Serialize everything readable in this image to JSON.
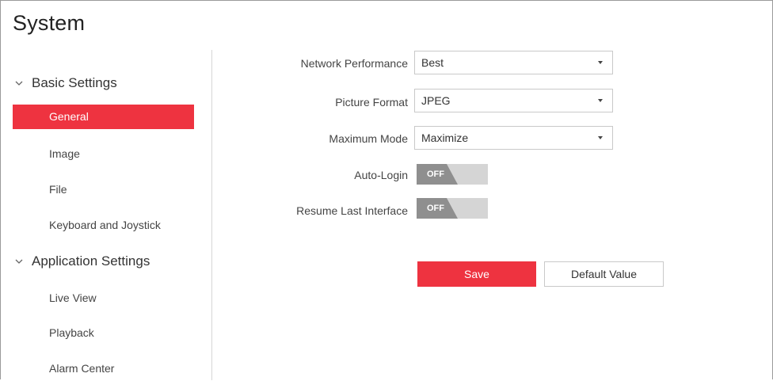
{
  "page": {
    "title": "System"
  },
  "sidebar": {
    "groups": [
      {
        "label": "Basic Settings",
        "items": [
          {
            "label": "General",
            "active": true
          },
          {
            "label": "Image"
          },
          {
            "label": "File"
          },
          {
            "label": "Keyboard and Joystick"
          }
        ]
      },
      {
        "label": "Application Settings",
        "items": [
          {
            "label": "Live View"
          },
          {
            "label": "Playback"
          },
          {
            "label": "Alarm Center"
          }
        ]
      }
    ]
  },
  "form": {
    "network_performance": {
      "label": "Network Performance",
      "value": "Best"
    },
    "picture_format": {
      "label": "Picture Format",
      "value": "JPEG"
    },
    "maximum_mode": {
      "label": "Maximum Mode",
      "value": "Maximize"
    },
    "auto_login": {
      "label": "Auto-Login",
      "state": "OFF"
    },
    "resume_last_interface": {
      "label": "Resume Last Interface",
      "state": "OFF"
    }
  },
  "actions": {
    "save": "Save",
    "default_value": "Default Value"
  },
  "colors": {
    "accent": "#ee3340",
    "toggle_off": "#8f8f8f",
    "toggle_track": "#d5d5d5"
  }
}
